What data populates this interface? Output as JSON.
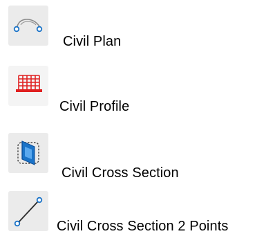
{
  "tools": [
    {
      "label": "Civil Plan",
      "icon": "civil-plan-icon"
    },
    {
      "label": "Civil Profile",
      "icon": "civil-profile-icon"
    },
    {
      "label": "Civil Cross Section",
      "icon": "civil-cross-section-icon"
    },
    {
      "label": "Civil Cross Section 2 Points",
      "icon": "civil-cross-section-2-points-icon"
    }
  ],
  "colors": {
    "icon_background": "#ebebeb",
    "blue_accent": "#1a73c8",
    "red_accent": "#e02020",
    "text": "#000000"
  }
}
